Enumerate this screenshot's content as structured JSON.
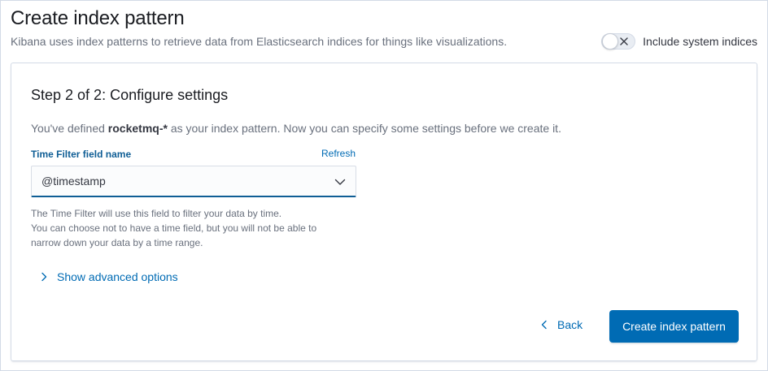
{
  "header": {
    "title": "Create index pattern",
    "description": "Kibana uses index patterns to retrieve data from Elasticsearch indices for things like visualizations.",
    "system_indices_label": "Include system indices",
    "system_indices_enabled": false
  },
  "step": {
    "title": "Step 2 of 2: Configure settings",
    "desc_prefix": "You've defined ",
    "pattern": "rocketmq-*",
    "desc_suffix": " as your index pattern. Now you can specify some settings before we create it."
  },
  "time_field": {
    "label": "Time Filter field name",
    "refresh_label": "Refresh",
    "selected": "@timestamp",
    "help_line1": "The Time Filter will use this field to filter your data by time.",
    "help_line2": "You can choose not to have a time field, but you will not be able to",
    "help_line3": "narrow down your data by a time range."
  },
  "advanced": {
    "label": "Show advanced options"
  },
  "actions": {
    "back_label": "Back",
    "create_label": "Create index pattern"
  },
  "colors": {
    "primary": "#006bb4",
    "label": "#0f5e95",
    "subdued_text": "#69707d"
  },
  "icons": {
    "toggle_off": "cross-icon",
    "select": "chevron-down-icon",
    "advanced": "chevron-right-icon",
    "back": "chevron-left-icon"
  }
}
